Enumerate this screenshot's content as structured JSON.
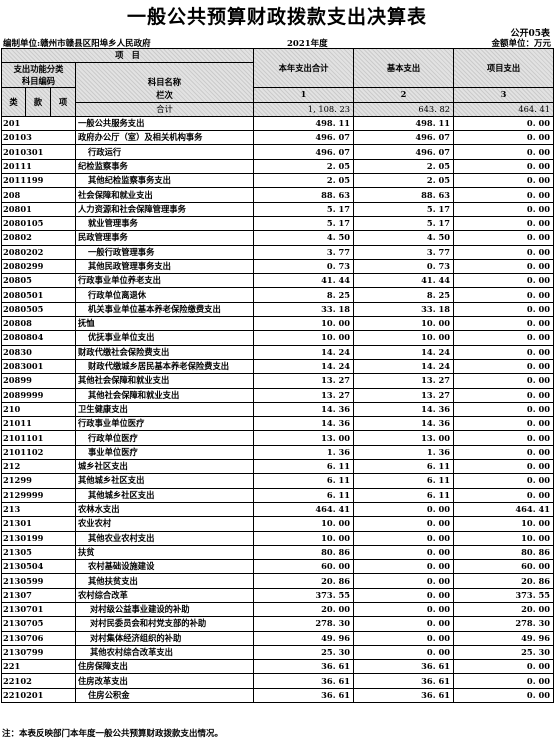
{
  "title": "一般公共预算财政拨款支出决算表",
  "form_no": "公开05表",
  "org_label": "编制单位:",
  "org_name": "赣州市赣县区阳埠乡人民政府",
  "year": "2021年度",
  "money_unit": "金额单位：万元",
  "header": {
    "item": "项　目",
    "func_class": "支出功能分类",
    "subject_code": "科目编码",
    "subject_name": "科目名称",
    "total": "本年支出合计",
    "basic": "基本支出",
    "project": "项目支出",
    "lei": "类",
    "kuan": "款",
    "xiang": "项",
    "lanci": "栏次",
    "col1": "1",
    "col2": "2",
    "col3": "3",
    "heji": "合计"
  },
  "totals": {
    "total": "1, 108. 23",
    "basic": "643. 82",
    "project": "464. 41"
  },
  "rows": [
    {
      "code": "201",
      "name": "一般公共服务支出",
      "indent": 0,
      "total": "498. 11",
      "basic": "498. 11",
      "project": "0. 00"
    },
    {
      "code": "20103",
      "name": "政府办公厅（室）及相关机构事务",
      "indent": 0,
      "total": "496. 07",
      "basic": "496. 07",
      "project": "0. 00"
    },
    {
      "code": "2010301",
      "name": "行政运行",
      "indent": 1,
      "total": "496. 07",
      "basic": "496. 07",
      "project": "0. 00"
    },
    {
      "code": "20111",
      "name": "纪检监察事务",
      "indent": 0,
      "total": "2. 05",
      "basic": "2. 05",
      "project": "0. 00"
    },
    {
      "code": "2011199",
      "name": "其他纪检监察事务支出",
      "indent": 1,
      "total": "2. 05",
      "basic": "2. 05",
      "project": "0. 00"
    },
    {
      "code": "208",
      "name": "社会保障和就业支出",
      "indent": 0,
      "total": "88. 63",
      "basic": "88. 63",
      "project": "0. 00"
    },
    {
      "code": "20801",
      "name": "人力资源和社会保障管理事务",
      "indent": 0,
      "total": "5. 17",
      "basic": "5. 17",
      "project": "0. 00"
    },
    {
      "code": "2080105",
      "name": "就业管理事务",
      "indent": 1,
      "total": "5. 17",
      "basic": "5. 17",
      "project": "0. 00"
    },
    {
      "code": "20802",
      "name": "民政管理事务",
      "indent": 0,
      "total": "4. 50",
      "basic": "4. 50",
      "project": "0. 00"
    },
    {
      "code": "2080202",
      "name": "一般行政管理事务",
      "indent": 1,
      "total": "3. 77",
      "basic": "3. 77",
      "project": "0. 00"
    },
    {
      "code": "2080299",
      "name": "其他民政管理事务支出",
      "indent": 1,
      "total": "0. 73",
      "basic": "0. 73",
      "project": "0. 00"
    },
    {
      "code": "20805",
      "name": "行政事业单位养老支出",
      "indent": 0,
      "total": "41. 44",
      "basic": "41. 44",
      "project": "0. 00"
    },
    {
      "code": "2080501",
      "name": "行政单位离退休",
      "indent": 1,
      "total": "8. 25",
      "basic": "8. 25",
      "project": "0. 00"
    },
    {
      "code": "2080505",
      "name": "机关事业单位基本养老保险缴费支出",
      "indent": 1,
      "total": "33. 18",
      "basic": "33. 18",
      "project": "0. 00"
    },
    {
      "code": "20808",
      "name": "抚恤",
      "indent": 0,
      "total": "10. 00",
      "basic": "10. 00",
      "project": "0. 00"
    },
    {
      "code": "2080804",
      "name": "优抚事业单位支出",
      "indent": 1,
      "total": "10. 00",
      "basic": "10. 00",
      "project": "0. 00"
    },
    {
      "code": "20830",
      "name": "财政代缴社会保险费支出",
      "indent": 0,
      "total": "14. 24",
      "basic": "14. 24",
      "project": "0. 00"
    },
    {
      "code": "2083001",
      "name": "财政代缴城乡居民基本养老保险费支出",
      "indent": 1,
      "total": "14. 24",
      "basic": "14. 24",
      "project": "0. 00"
    },
    {
      "code": "20899",
      "name": "其他社会保障和就业支出",
      "indent": 0,
      "total": "13. 27",
      "basic": "13. 27",
      "project": "0. 00"
    },
    {
      "code": "2089999",
      "name": "其他社会保障和就业支出",
      "indent": 1,
      "total": "13. 27",
      "basic": "13. 27",
      "project": "0. 00"
    },
    {
      "code": "210",
      "name": "卫生健康支出",
      "indent": 0,
      "total": "14. 36",
      "basic": "14. 36",
      "project": "0. 00"
    },
    {
      "code": "21011",
      "name": "行政事业单位医疗",
      "indent": 0,
      "total": "14. 36",
      "basic": "14. 36",
      "project": "0. 00"
    },
    {
      "code": "2101101",
      "name": "行政单位医疗",
      "indent": 1,
      "total": "13. 00",
      "basic": "13. 00",
      "project": "0. 00"
    },
    {
      "code": "2101102",
      "name": "事业单位医疗",
      "indent": 1,
      "total": "1. 36",
      "basic": "1. 36",
      "project": "0. 00"
    },
    {
      "code": "212",
      "name": "城乡社区支出",
      "indent": 0,
      "total": "6. 11",
      "basic": "6. 11",
      "project": "0. 00"
    },
    {
      "code": "21299",
      "name": "其他城乡社区支出",
      "indent": 0,
      "total": "6. 11",
      "basic": "6. 11",
      "project": "0. 00"
    },
    {
      "code": "2129999",
      "name": "其他城乡社区支出",
      "indent": 1,
      "total": "6. 11",
      "basic": "6. 11",
      "project": "0. 00"
    },
    {
      "code": "213",
      "name": "农林水支出",
      "indent": 0,
      "total": "464. 41",
      "basic": "0. 00",
      "project": "464. 41"
    },
    {
      "code": "21301",
      "name": "农业农村",
      "indent": 0,
      "total": "10. 00",
      "basic": "0. 00",
      "project": "10. 00"
    },
    {
      "code": "2130199",
      "name": "其他农业农村支出",
      "indent": 1,
      "total": "10. 00",
      "basic": "0. 00",
      "project": "10. 00"
    },
    {
      "code": "21305",
      "name": "扶贫",
      "indent": 0,
      "total": "80. 86",
      "basic": "0. 00",
      "project": "80. 86"
    },
    {
      "code": "2130504",
      "name": "农村基础设施建设",
      "indent": 1,
      "total": "60. 00",
      "basic": "0. 00",
      "project": "60. 00"
    },
    {
      "code": "2130599",
      "name": "其他扶贫支出",
      "indent": 1,
      "total": "20. 86",
      "basic": "0. 00",
      "project": "20. 86"
    },
    {
      "code": "21307",
      "name": "农村综合改革",
      "indent": 0,
      "total": "373. 55",
      "basic": "0. 00",
      "project": "373. 55"
    },
    {
      "code": "2130701",
      "name": "对村级公益事业建设的补助",
      "indent": 2,
      "total": "20. 00",
      "basic": "0. 00",
      "project": "20. 00"
    },
    {
      "code": "2130705",
      "name": "对村民委员会和村党支部的补助",
      "indent": 2,
      "total": "278. 30",
      "basic": "0. 00",
      "project": "278. 30"
    },
    {
      "code": "2130706",
      "name": "对村集体经济组织的补助",
      "indent": 2,
      "total": "49. 96",
      "basic": "0. 00",
      "project": "49. 96"
    },
    {
      "code": "2130799",
      "name": "其他农村综合改革支出",
      "indent": 2,
      "total": "25. 30",
      "basic": "0. 00",
      "project": "25. 30"
    },
    {
      "code": "221",
      "name": "住房保障支出",
      "indent": 0,
      "total": "36. 61",
      "basic": "36. 61",
      "project": "0. 00"
    },
    {
      "code": "22102",
      "name": "住房改革支出",
      "indent": 0,
      "total": "36. 61",
      "basic": "36. 61",
      "project": "0. 00"
    },
    {
      "code": "2210201",
      "name": "住房公积金",
      "indent": 1,
      "total": "36. 61",
      "basic": "36. 61",
      "project": "0. 00"
    }
  ],
  "footnote": "注：本表反映部门本年度一般公共预算财政拨款支出情况。"
}
